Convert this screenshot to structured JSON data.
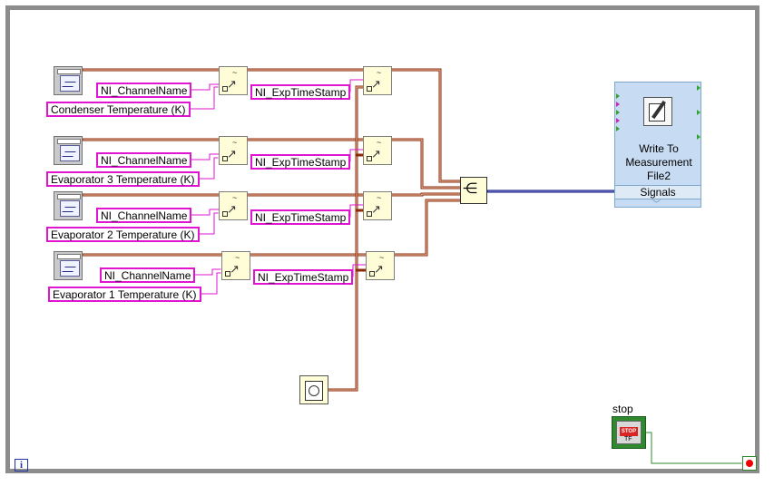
{
  "diagram": {
    "loop_info_icon": "i",
    "rows": [
      {
        "channel_name": "NI_ChannelName",
        "label": "Condenser Temperature (K)",
        "timestamp": "NI_ExpTimeStamp"
      },
      {
        "channel_name": "NI_ChannelName",
        "label": "Evaporator 3 Temperature (K)",
        "timestamp": "NI_ExpTimeStamp"
      },
      {
        "channel_name": "NI_ChannelName",
        "label": "Evaporator 2 Temperature (K)",
        "timestamp": "NI_ExpTimeStamp"
      },
      {
        "channel_name": "NI_ChannelName",
        "label": "Evaporator 1 Temperature (K)",
        "timestamp": "NI_ExpTimeStamp"
      }
    ],
    "write_node": {
      "title_line1": "Write To",
      "title_line2": "Measurement",
      "title_line3": "File2",
      "input_terminal": "Signals",
      "icon": "write-file-icon",
      "bg_color": "#c7dcf2"
    },
    "stop": {
      "label": "stop",
      "button_text": "STOP",
      "indicator": "TF",
      "accent": "#2f8a2f"
    },
    "wire_colors": {
      "dynamic_data": "#8b2a0a",
      "string": "#e015d0",
      "merged": "#0a0a7a"
    }
  }
}
